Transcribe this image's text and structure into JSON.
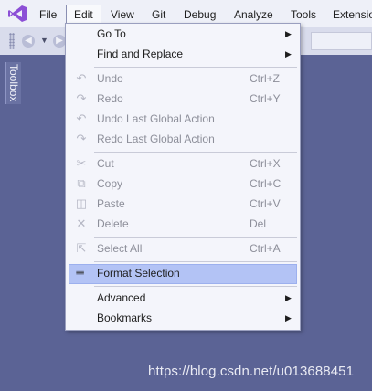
{
  "menubar": {
    "items": [
      {
        "label": "File"
      },
      {
        "label": "Edit"
      },
      {
        "label": "View"
      },
      {
        "label": "Git"
      },
      {
        "label": "Debug"
      },
      {
        "label": "Analyze"
      },
      {
        "label": "Tools"
      },
      {
        "label": "Extensio"
      }
    ],
    "active": "Edit"
  },
  "sidebar": {
    "toolbox_label": "Toolbox"
  },
  "edit_menu": {
    "items": [
      {
        "label": "Go To",
        "shortcut": "",
        "submenu": true,
        "enabled": true,
        "icon": ""
      },
      {
        "label": "Find and Replace",
        "shortcut": "",
        "submenu": true,
        "enabled": true,
        "icon": ""
      },
      {
        "label": "Undo",
        "shortcut": "Ctrl+Z",
        "submenu": false,
        "enabled": false,
        "icon": "undo-icon"
      },
      {
        "label": "Redo",
        "shortcut": "Ctrl+Y",
        "submenu": false,
        "enabled": false,
        "icon": "redo-icon"
      },
      {
        "label": "Undo Last Global Action",
        "shortcut": "",
        "submenu": false,
        "enabled": false,
        "icon": "undo-icon"
      },
      {
        "label": "Redo Last Global Action",
        "shortcut": "",
        "submenu": false,
        "enabled": false,
        "icon": "redo-icon"
      },
      {
        "label": "Cut",
        "shortcut": "Ctrl+X",
        "submenu": false,
        "enabled": false,
        "icon": "cut-icon"
      },
      {
        "label": "Copy",
        "shortcut": "Ctrl+C",
        "submenu": false,
        "enabled": false,
        "icon": "copy-icon"
      },
      {
        "label": "Paste",
        "shortcut": "Ctrl+V",
        "submenu": false,
        "enabled": false,
        "icon": "paste-icon"
      },
      {
        "label": "Delete",
        "shortcut": "Del",
        "submenu": false,
        "enabled": false,
        "icon": "delete-icon"
      },
      {
        "label": "Select All",
        "shortcut": "Ctrl+A",
        "submenu": false,
        "enabled": false,
        "icon": "select-all-icon"
      },
      {
        "label": "Format Selection",
        "shortcut": "",
        "submenu": false,
        "enabled": true,
        "icon": "format-selection-icon",
        "highlighted": true
      },
      {
        "label": "Advanced",
        "shortcut": "",
        "submenu": true,
        "enabled": true,
        "icon": ""
      },
      {
        "label": "Bookmarks",
        "shortcut": "",
        "submenu": true,
        "enabled": true,
        "icon": ""
      }
    ]
  },
  "watermark": "https://blog.csdn.net/u013688451",
  "colors": {
    "background": "#5b6395",
    "menubar": "#eef0f8",
    "dropdown": "#f4f5fb",
    "highlight": "#b3c3f5",
    "logo": "#8c4fd6"
  }
}
